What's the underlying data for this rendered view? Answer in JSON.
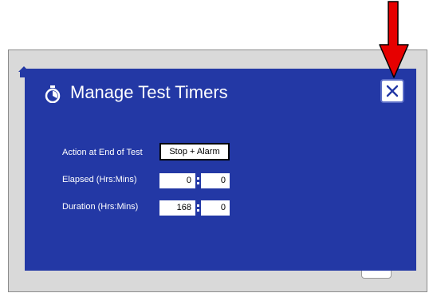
{
  "dialog": {
    "title": "Manage Test Timers",
    "close_icon": "close-x-icon",
    "header_icon": "stopwatch-icon"
  },
  "fields": {
    "action_label": "Action at End of Test",
    "action_value": "Stop + Alarm",
    "elapsed_label": "Elapsed (Hrs:Mins)",
    "elapsed_hours": "0",
    "elapsed_mins": "0",
    "duration_label": "Duration (Hrs:Mins)",
    "duration_hours": "168",
    "duration_mins": "0"
  },
  "annotation": {
    "arrow_color": "#e60000",
    "arrow_icon": "red-arrow-down-icon"
  },
  "colors": {
    "dialog_bg": "#2338a5",
    "screen_bg": "#d9d9d9"
  }
}
